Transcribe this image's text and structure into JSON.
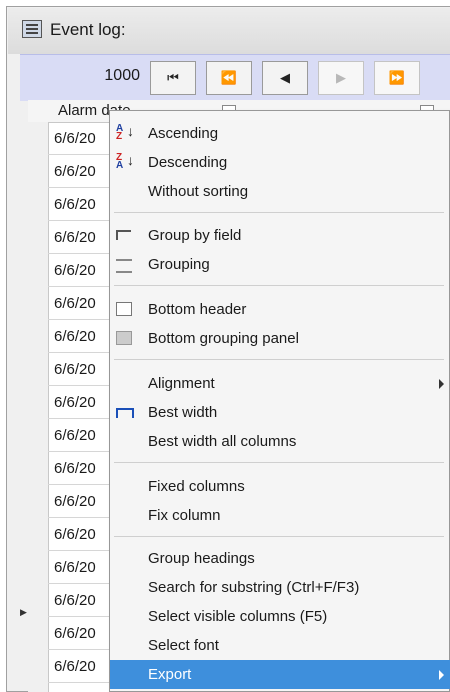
{
  "window": {
    "title": "Event log:"
  },
  "navigator": {
    "record_count": "1000",
    "buttons": [
      {
        "name": "first-record",
        "glyph": "⏮"
      },
      {
        "name": "prev-page",
        "glyph": "⏪"
      },
      {
        "name": "prev-record",
        "glyph": "◀"
      },
      {
        "name": "next-record",
        "glyph": "▶"
      },
      {
        "name": "next-page",
        "glyph": "⏩"
      }
    ]
  },
  "grid": {
    "column_header": "Alarm date",
    "row_value": "6/6/20"
  },
  "context_menu": {
    "ascending": "Ascending",
    "descending": "Descending",
    "without_sorting": "Without sorting",
    "group_by_field": "Group by field",
    "grouping": "Grouping",
    "bottom_header": "Bottom header",
    "bottom_grouping_panel": "Bottom grouping panel",
    "alignment": "Alignment",
    "best_width": "Best width",
    "best_width_all": "Best width all columns",
    "fixed_columns": "Fixed columns",
    "fix_column": "Fix column",
    "group_headings": "Group headings",
    "search_substring": "Search for substring (Ctrl+F/F3)",
    "select_visible_columns": "Select visible columns (F5)",
    "select_font": "Select font",
    "export": "Export"
  },
  "colors": {
    "navbar_bg": "#d9dcf5",
    "highlight": "#3e8fdc"
  }
}
